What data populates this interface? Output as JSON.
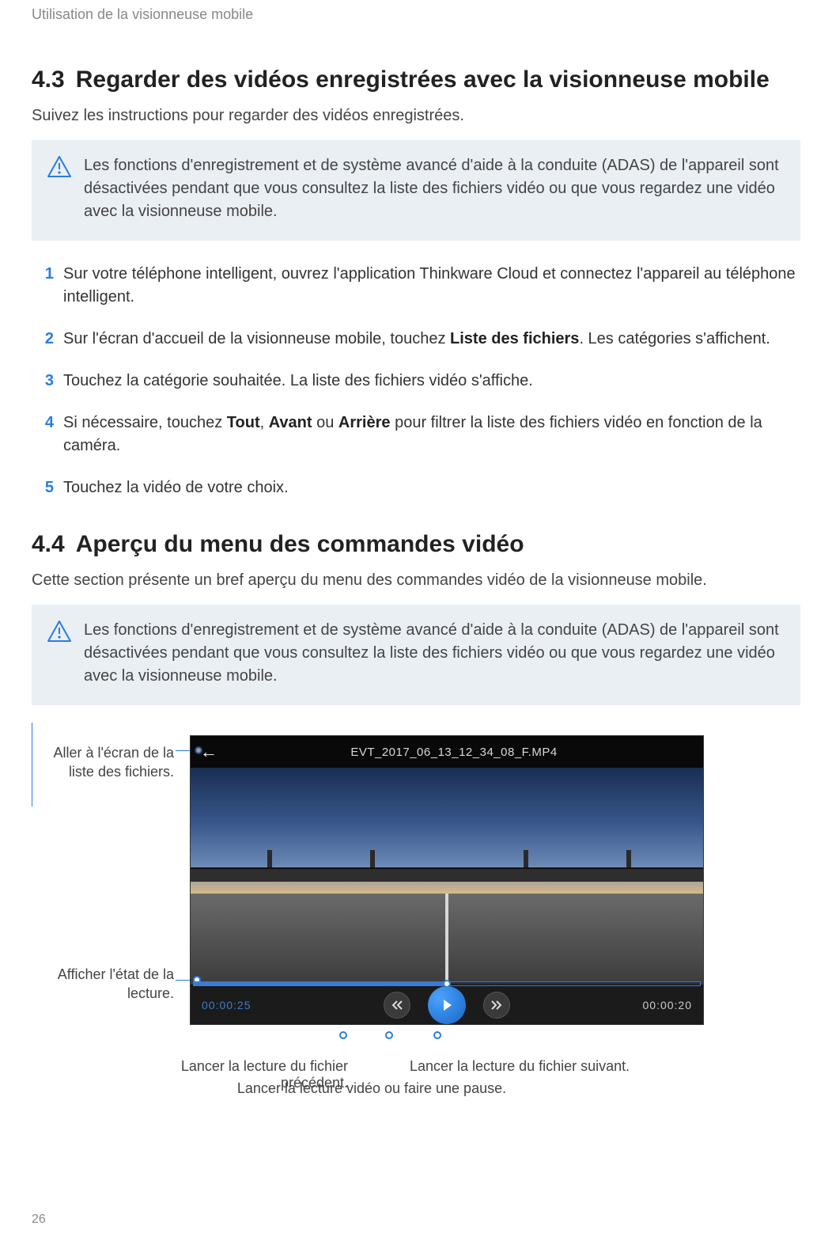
{
  "header": "Utilisation de la visionneuse mobile",
  "section43": {
    "number": "4.3",
    "title": "Regarder des vidéos enregistrées avec la visionneuse mobile",
    "intro": "Suivez les instructions pour regarder des vidéos enregistrées.",
    "warning": "Les fonctions d'enregistrement et de système avancé d'aide à la conduite (ADAS) de l'appareil sont désactivées pendant que vous consultez la liste des fichiers vidéo ou que vous regardez une vidéo avec la visionneuse mobile.",
    "steps": {
      "s1": "Sur votre téléphone intelligent, ouvrez l'application Thinkware Cloud et connectez l'appareil au téléphone intelligent.",
      "s2_pre": "Sur l'écran d'accueil de la visionneuse mobile, touchez ",
      "s2_bold": "Liste des fichiers",
      "s2_post": ". Les catégories s'affichent.",
      "s3": "Touchez la catégorie souhaitée. La liste des fichiers vidéo s'affiche.",
      "s4_pre": "Si nécessaire, touchez ",
      "s4_b1": "Tout",
      "s4_mid1": ", ",
      "s4_b2": "Avant",
      "s4_mid2": " ou ",
      "s4_b3": "Arrière",
      "s4_post": " pour filtrer la liste des fichiers vidéo en fonction de la caméra.",
      "s5": "Touchez la vidéo de votre choix."
    }
  },
  "section44": {
    "number": "4.4",
    "title": "Aperçu du menu des commandes vidéo",
    "intro": "Cette section présente un bref aperçu du menu des commandes vidéo de la visionneuse mobile.",
    "warning": "Les fonctions d'enregistrement et de système avancé d'aide à la conduite (ADAS) de l'appareil sont désactivées pendant que vous consultez la liste des fichiers vidéo ou que vous regardez une vidéo avec la visionneuse mobile."
  },
  "player": {
    "filename": "EVT_2017_06_13_12_34_08_F.MP4",
    "elapsed": "00:00:25",
    "duration": "00:00:20"
  },
  "callouts": {
    "back": "Aller à l'écran de la liste des fichiers.",
    "status": "Afficher l'état de la lecture.",
    "prev": "Lancer la lecture du fichier précédent.",
    "next": "Lancer la lecture du fichier suivant.",
    "play": "Lancer la lecture vidéo ou faire une pause."
  },
  "pageNumber": "26"
}
